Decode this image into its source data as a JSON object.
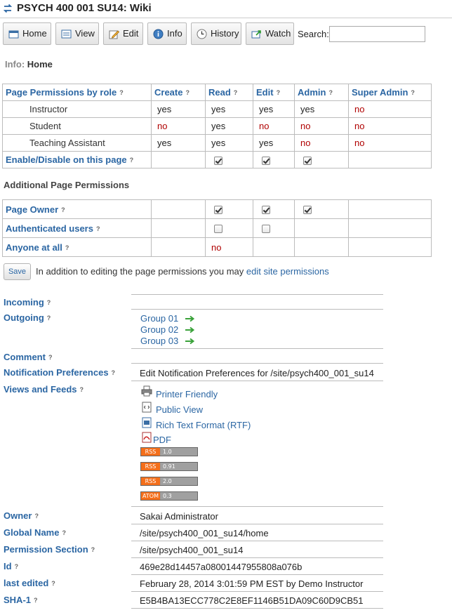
{
  "header": {
    "title": "PSYCH 400 001 SU14: Wiki"
  },
  "toolbar": {
    "home": "Home",
    "view": "View",
    "edit": "Edit",
    "info": "Info",
    "history": "History",
    "watch": "Watch",
    "search_label": "Search:",
    "search_value": ""
  },
  "breadcrumb": {
    "label": "Info:",
    "page": "Home"
  },
  "permissions": {
    "headers": [
      "Page Permissions by role",
      "Create",
      "Read",
      "Edit",
      "Admin",
      "Super Admin"
    ],
    "rows": [
      {
        "role": "Instructor",
        "values": [
          "yes",
          "yes",
          "yes",
          "yes",
          "no"
        ]
      },
      {
        "role": "Student",
        "values": [
          "no",
          "yes",
          "no",
          "no",
          "no"
        ]
      },
      {
        "role": "Teaching Assistant",
        "values": [
          "yes",
          "yes",
          "yes",
          "no",
          "no"
        ]
      }
    ],
    "enable_label": "Enable/Disable on this page",
    "enable_checks": [
      false,
      true,
      true,
      true,
      false
    ]
  },
  "additional": {
    "heading": "Additional Page Permissions",
    "rows": [
      {
        "label": "Page Owner",
        "checked": {
          "read": true,
          "edit": true,
          "admin": true
        }
      },
      {
        "label": "Authenticated users",
        "checked": {
          "read": false,
          "edit": false
        }
      },
      {
        "label": "Anyone at all",
        "read_value": "no"
      }
    ]
  },
  "save": {
    "button": "Save",
    "note": "In addition to editing the page permissions you may",
    "link": "edit site permissions"
  },
  "info": {
    "incoming": "Incoming",
    "outgoing": "Outgoing",
    "groups": [
      "Group 01",
      "Group 02",
      "Group 03"
    ],
    "comment": "Comment",
    "notification_label": "Notification Preferences",
    "notification_link": "Edit Notification Preferences for /site/psych400_001_su14",
    "views_label": "Views and Feeds",
    "feeds": [
      "Printer Friendly",
      "Public View",
      "Rich Text Format (RTF)",
      "PDF"
    ],
    "rss": [
      {
        "left": "RSS",
        "right": "1.0"
      },
      {
        "left": "RSS",
        "right": "0.91"
      },
      {
        "left": "RSS",
        "right": "2.0"
      },
      {
        "left": "ATOM",
        "right": "0.3"
      }
    ],
    "owner_label": "Owner",
    "owner": "Sakai Administrator",
    "global_name_label": "Global Name",
    "global_name": "/site/psych400_001_su14/home",
    "permission_section_label": "Permission Section",
    "permission_section": "/site/psych400_001_su14",
    "id_label": "Id",
    "id": "469e28d14457a08001447955808a076b",
    "last_edited_label": "last edited",
    "last_edited": "February 28, 2014 3:01:59 PM EST by Demo Instructor",
    "sha1_label": "SHA-1",
    "sha1": "E5B4BA13ECC778C2E8EF1146B51DA09C60D9CB51"
  },
  "help_mark": "?",
  "colors": {
    "link": "#2b66a3",
    "no": "#b00000",
    "rss_orange": "#f46f1b"
  }
}
